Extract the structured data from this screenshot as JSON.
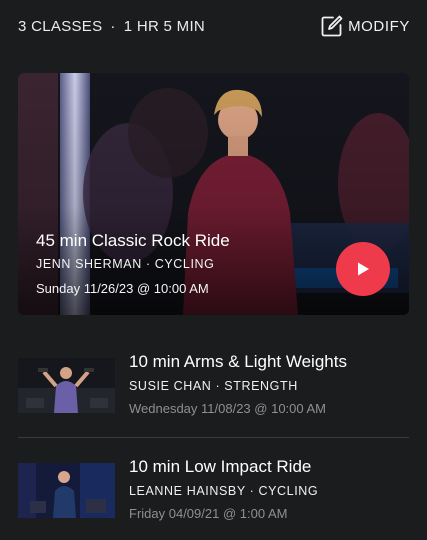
{
  "header": {
    "classes_count": "3 CLASSES",
    "separator": "·",
    "duration": "1 HR 5 MIN",
    "modify_label": "MODIFY"
  },
  "featured": {
    "title": "45 min Classic Rock Ride",
    "subtitle": "JENN SHERMAN · CYCLING",
    "date": "Sunday 11/26/23 @ 10:00 AM",
    "play_icon": "play-icon"
  },
  "classes": [
    {
      "title": "10 min Arms & Light Weights",
      "subtitle": "SUSIE CHAN · STRENGTH",
      "date": "Wednesday 11/08/23 @ 10:00 AM"
    },
    {
      "title": "10 min Low Impact Ride",
      "subtitle": "LEANNE HAINSBY · CYCLING",
      "date": "Friday 04/09/21 @ 1:00 AM"
    }
  ],
  "colors": {
    "background": "#1b1c1e",
    "accent": "#ee3a4a",
    "muted_text": "#8e8f93"
  }
}
